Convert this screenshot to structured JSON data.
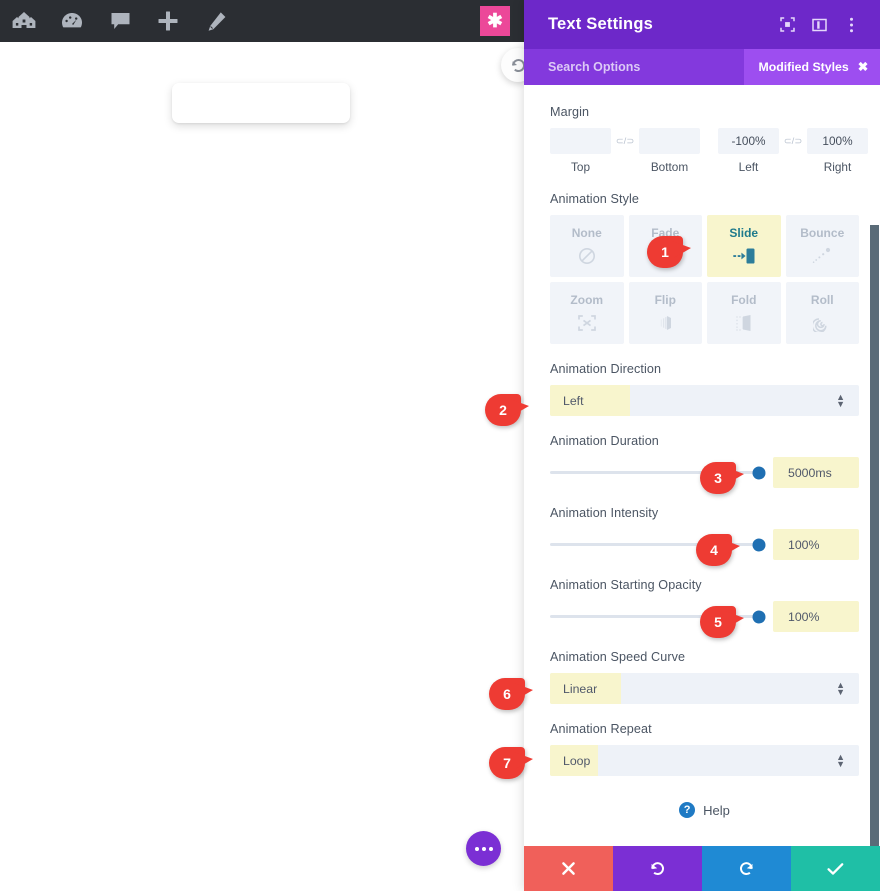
{
  "editor_toolbar": {
    "icons": [
      {
        "name": "wireframe-view-icon",
        "glyph": "buildings"
      },
      {
        "name": "dashboard-gauge-icon",
        "glyph": "gauge"
      },
      {
        "name": "comment-bubble-icon",
        "glyph": "comment"
      },
      {
        "name": "add-module-icon",
        "glyph": "plus"
      },
      {
        "name": "edit-pencil-icon",
        "glyph": "pencil"
      }
    ],
    "badge": {
      "name": "divi-star-badge",
      "glyph": "✱",
      "color": "#ec4899"
    }
  },
  "canvas": {
    "text_module_name": "text-module-preview",
    "history_button_name": "history-undo-circle-button",
    "fab_name": "page-settings-fab-button"
  },
  "panel": {
    "title": "Text Settings",
    "header_icons": [
      {
        "name": "expand-view-icon"
      },
      {
        "name": "panel-layout-icon"
      },
      {
        "name": "more-options-icon"
      }
    ],
    "search": {
      "placeholder": "Search Options",
      "modified_styles_label": "Modified Styles",
      "modified_styles_close": "✖"
    },
    "accent_color": "#6d28c9",
    "search_bar_color": "#8339dd",
    "badge_color": "#9d4ef0",
    "highlight_color": "#f8f5cd"
  },
  "margin": {
    "label": "Margin",
    "link_glyph": "⊂/⊃",
    "fields": [
      {
        "label": "Top",
        "value": ""
      },
      {
        "label": "Bottom",
        "value": ""
      },
      {
        "label": "Left",
        "value": "-100%"
      },
      {
        "label": "Right",
        "value": "100%"
      }
    ]
  },
  "animation_style": {
    "label": "Animation Style",
    "options": [
      {
        "label": "None",
        "icon": "no-entry-icon",
        "selected": false
      },
      {
        "label": "Fade",
        "icon": "fade-icon",
        "selected": false
      },
      {
        "label": "Slide",
        "icon": "slide-icon",
        "selected": true
      },
      {
        "label": "Bounce",
        "icon": "bounce-icon",
        "selected": false
      },
      {
        "label": "Zoom",
        "icon": "zoom-icon",
        "selected": false
      },
      {
        "label": "Flip",
        "icon": "flip-icon",
        "selected": false
      },
      {
        "label": "Fold",
        "icon": "fold-icon",
        "selected": false
      },
      {
        "label": "Roll",
        "icon": "roll-icon",
        "selected": false
      }
    ]
  },
  "animation_direction": {
    "label": "Animation Direction",
    "value": "Left"
  },
  "animation_duration": {
    "label": "Animation Duration",
    "value": "5000ms",
    "slider_percent": 100
  },
  "animation_intensity": {
    "label": "Animation Intensity",
    "value": "100%",
    "slider_percent": 100
  },
  "animation_starting_opacity": {
    "label": "Animation Starting Opacity",
    "value": "100%",
    "slider_percent": 100
  },
  "animation_speed_curve": {
    "label": "Animation Speed Curve",
    "value": "Linear"
  },
  "animation_repeat": {
    "label": "Animation Repeat",
    "value": "Loop"
  },
  "help": {
    "label": "Help",
    "icon_glyph": "?"
  },
  "footer": {
    "buttons": [
      {
        "name": "cancel-button",
        "glyph": "✖",
        "color": "#f0605a"
      },
      {
        "name": "undo-button",
        "glyph": "↺",
        "color": "#7b2fd4"
      },
      {
        "name": "redo-button",
        "glyph": "↻",
        "color": "#1f8ad4"
      },
      {
        "name": "save-button",
        "glyph": "✔",
        "color": "#1fbfa6"
      }
    ]
  },
  "markers": [
    {
      "num": "1"
    },
    {
      "num": "2"
    },
    {
      "num": "3"
    },
    {
      "num": "4"
    },
    {
      "num": "5"
    },
    {
      "num": "6"
    },
    {
      "num": "7"
    }
  ]
}
